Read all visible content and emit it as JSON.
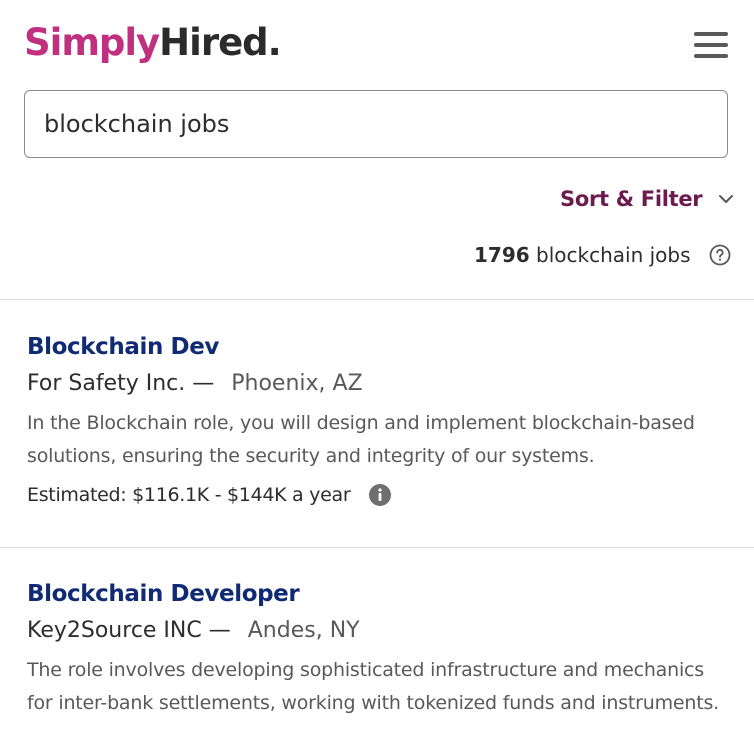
{
  "brand": {
    "logo_part1": "Simply",
    "logo_part2": "Hired",
    "logo_suffix": ".",
    "primary_color": "#c0307e",
    "dark_color": "#2b2b2b"
  },
  "header": {
    "menu_icon": "hamburger-menu-icon"
  },
  "search": {
    "value": "blockchain jobs"
  },
  "filter": {
    "label": "Sort & Filter",
    "icon": "chevron-down-icon",
    "color": "#6c1b4f"
  },
  "results": {
    "count": "1796",
    "count_label": "blockchain jobs",
    "help_icon": "question-circle-icon"
  },
  "jobs": [
    {
      "title": "Blockchain Dev",
      "company": "For Safety Inc.",
      "separator": "—",
      "location": "Phoenix, AZ",
      "description": "In the Blockchain role, you will design and implement blockchain-based solutions, ensuring the security and integrity of our systems.",
      "salary": "Estimated: $116.1K - $144K a year",
      "salary_icon": "info-icon"
    },
    {
      "title": "Blockchain Developer",
      "company": "Key2Source INC",
      "separator": "—",
      "location": "Andes, NY",
      "description": "The role involves developing sophisticated infrastructure and mechanics for inter-bank settlements, working with tokenized funds and instruments."
    }
  ],
  "colors": {
    "job_title": "#102a73",
    "secondary_text": "#595959",
    "divider": "#d9d9d9"
  }
}
